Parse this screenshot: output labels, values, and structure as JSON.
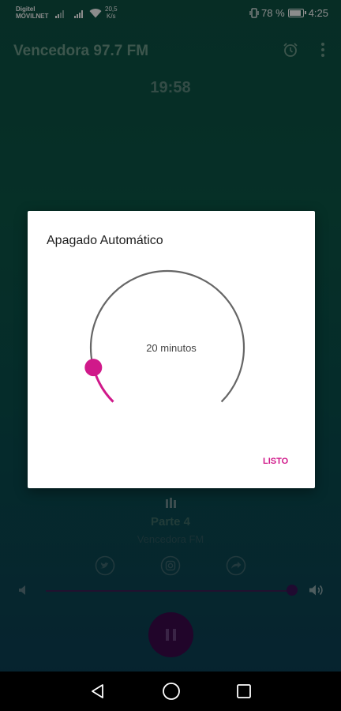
{
  "status_bar": {
    "carrier_line1": "Digitel",
    "carrier_line2": "MOVILNET",
    "net_speed_value": "20,5",
    "net_speed_unit": "K/s",
    "battery_percent": "78 %",
    "time": "4:25"
  },
  "app_bar": {
    "title": "Vencedora 97.7 FM",
    "icons": [
      "alarm-icon",
      "more-vert-icon"
    ]
  },
  "sleep_timer_display": "19:58",
  "dialog": {
    "title": "Apagado Automático",
    "dial_value_label": "20 minutos",
    "dial_progress_fraction": 0.111,
    "confirm_label": "LISTO"
  },
  "player": {
    "track_title": "Parte 4",
    "station_name": "Vencedora FM",
    "social_icons": [
      "twitter-icon",
      "instagram-icon",
      "share-icon"
    ],
    "volume_fraction": 0.98,
    "state": "playing"
  },
  "colors": {
    "accent": "#d0198a",
    "background_top": "#0d5244",
    "background_bottom": "#0b3f58",
    "play_button": "#3c0a4e"
  },
  "nav_bar": {
    "icons": [
      "back-icon",
      "home-icon",
      "recent-apps-icon"
    ]
  }
}
